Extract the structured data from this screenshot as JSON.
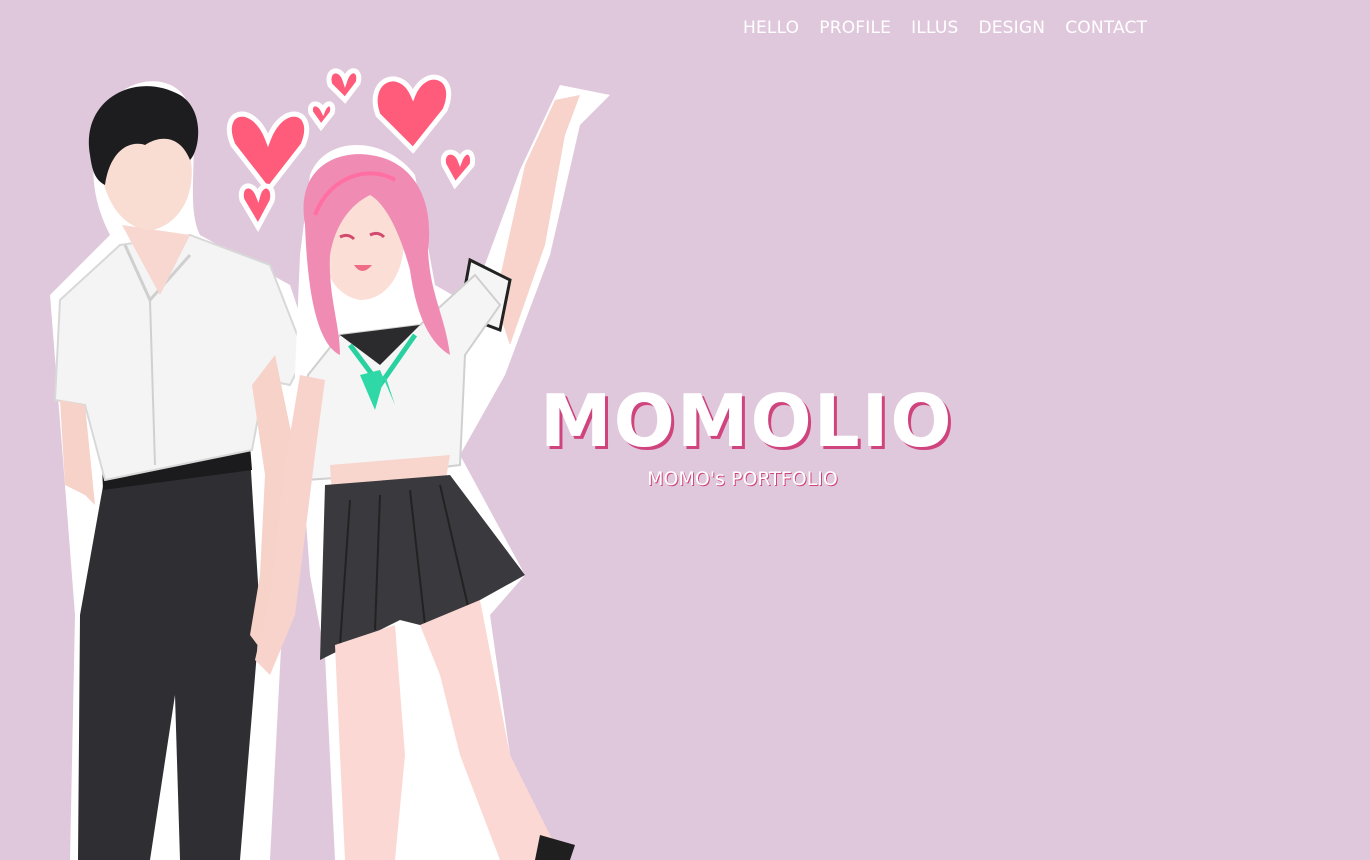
{
  "nav": {
    "items": [
      {
        "label": "HELLO"
      },
      {
        "label": "PROFILE"
      },
      {
        "label": "ILLUS"
      },
      {
        "label": "DESIGN"
      },
      {
        "label": "CONTACT"
      }
    ]
  },
  "hero": {
    "title": "MOMOLIO",
    "subtitle": "MOMO's PORTFOLIO"
  },
  "colors": {
    "background": "#e0c8dc",
    "accent": "#d0447d",
    "heart": "#ff5c7c",
    "hair_pink": "#f08cb4"
  }
}
